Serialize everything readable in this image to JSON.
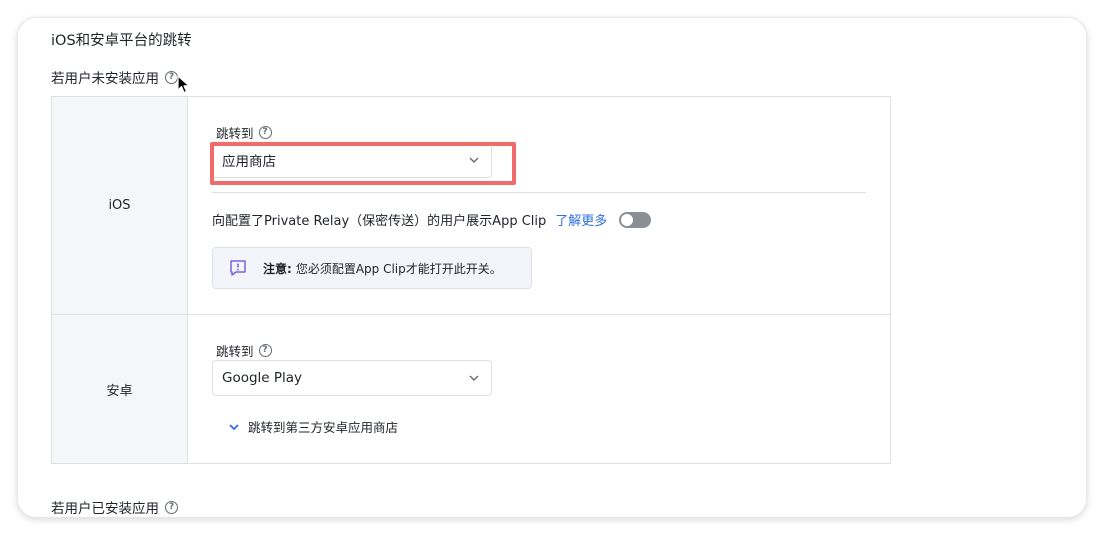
{
  "section_title": "iOS和安卓平台的跳转",
  "not_installed": {
    "label": "若用户未安装应用",
    "help": "?"
  },
  "installed": {
    "label": "若用户已安装应用",
    "help": "?"
  },
  "ios": {
    "platform_label": "iOS",
    "jump_label": "跳转到",
    "jump_help": "?",
    "jump_value": "应用商店",
    "relay_text": "向配置了Private Relay（保密传送）的用户展示App Clip",
    "learn_more": "了解更多",
    "relay_toggle_on": false,
    "note_bold": "注意:",
    "note_text": "您必须配置App Clip才能打开此开关。"
  },
  "android": {
    "platform_label": "安卓",
    "jump_label": "跳转到",
    "jump_help": "?",
    "jump_value": "Google Play",
    "third_party_label": "跳转到第三方安卓应用商店"
  },
  "colors": {
    "highlight": "#f26b6b",
    "link": "#2f6fde",
    "toggle_off": "#8a8f96",
    "note_icon": "#7b61d9"
  }
}
